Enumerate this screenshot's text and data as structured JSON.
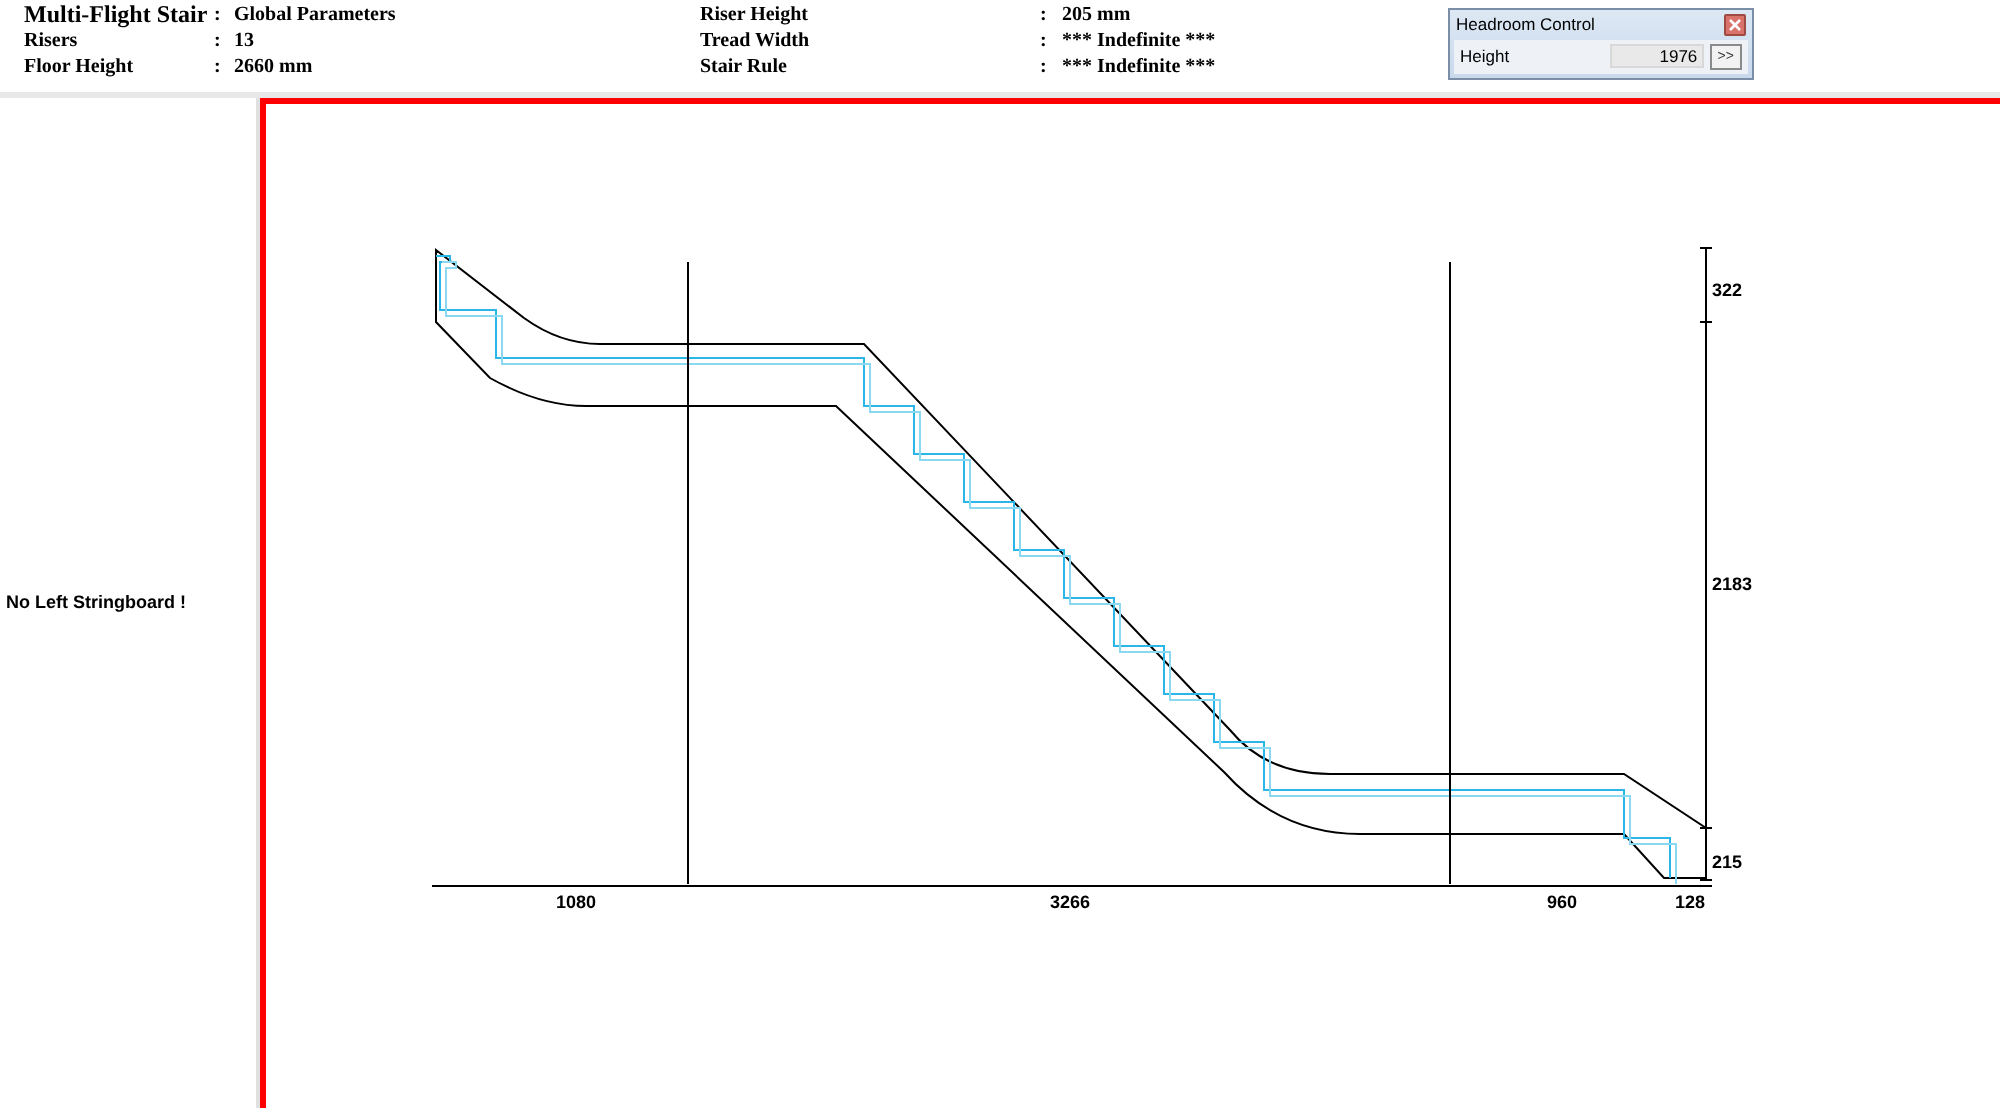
{
  "header": {
    "left": [
      {
        "kind": "title",
        "label": "Multi-Flight Stair",
        "sep": ":",
        "value": "Global Parameters"
      },
      {
        "kind": "row",
        "label": "Risers",
        "sep": ":",
        "value": "13"
      },
      {
        "kind": "row",
        "label": "Floor Height",
        "sep": ":",
        "value": "2660 mm"
      }
    ],
    "right": [
      {
        "label": "Riser Height",
        "sep": ":",
        "value": "205 mm"
      },
      {
        "label": "Tread Width",
        "sep": ":",
        "value": "*** Indefinite ***"
      },
      {
        "label": "Stair Rule",
        "sep": ":",
        "value": "*** Indefinite ***"
      }
    ]
  },
  "headroom_control": {
    "title": "Headroom Control",
    "field_label": "Height",
    "value": "1976",
    "button": ">>"
  },
  "side_panel": {
    "message": "No Left Stringboard !"
  },
  "dimensions": {
    "vertical": [
      "322",
      "2183",
      "215"
    ],
    "horizontal": [
      "1080",
      "3266",
      "960",
      "128"
    ]
  }
}
